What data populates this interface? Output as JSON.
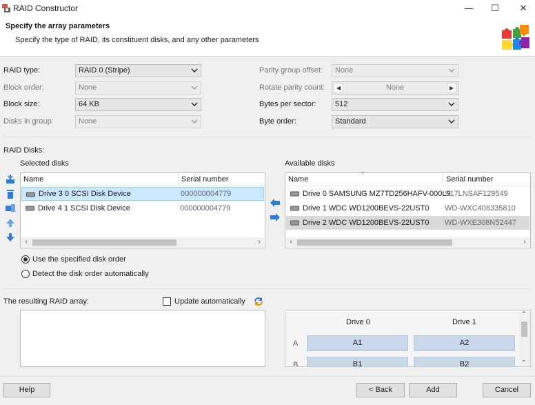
{
  "window": {
    "title": "RAID Constructor",
    "minimize": "—",
    "maximize": "☐",
    "close": "✕"
  },
  "header": {
    "heading": "Specify the array parameters",
    "description": "Specify the type of RAID, its constituent disks, and any other parameters"
  },
  "params": {
    "raid_type_label": "RAID type:",
    "raid_type_value": "RAID 0 (Stripe)",
    "block_order_label": "Block order:",
    "block_order_value": "None",
    "block_size_label": "Block size:",
    "block_size_value": "64 KB",
    "disks_in_group_label": "Disks in group:",
    "disks_in_group_value": "None",
    "parity_offset_label": "Parity group offset:",
    "parity_offset_value": "None",
    "rotate_parity_label": "Rotate parity count:",
    "rotate_parity_value": "None",
    "bytes_per_sector_label": "Bytes per sector:",
    "bytes_per_sector_value": "512",
    "byte_order_label": "Byte order:",
    "byte_order_value": "Standard"
  },
  "disks": {
    "section_label": "RAID Disks:",
    "selected_label": "Selected disks",
    "available_label": "Available disks",
    "col_name": "Name",
    "col_serial": "Serial number",
    "selected": [
      {
        "name": "Drive 3 0 SCSI Disk Device",
        "serial": "000000004779"
      },
      {
        "name": "Drive 4 1 SCSI Disk Device",
        "serial": "000000004779"
      }
    ],
    "available": [
      {
        "name": "Drive 0 SAMSUNG MZ7TD256HAFV-000L9",
        "serial": "S17LNSAF129549"
      },
      {
        "name": "Drive 1 WDC WD1200BEVS-22UST0",
        "serial": "WD-WXC408335810"
      },
      {
        "name": "Drive 2 WDC WD1200BEVS-22UST0",
        "serial": "WD-WXE308N52447"
      }
    ]
  },
  "order": {
    "use_specified": "Use the specified disk order",
    "detect_auto": "Detect the disk order automatically"
  },
  "result": {
    "label": "The resulting RAID array:",
    "update_auto": "Update automatically",
    "col1": "Drive 0",
    "col2": "Drive 1",
    "row_a": "A",
    "row_b": "B",
    "a1": "A1",
    "a2": "A2",
    "b1": "B1",
    "b2": "B2"
  },
  "footer": {
    "help": "Help",
    "back": "< Back",
    "add": "Add",
    "cancel": "Cancel"
  },
  "colors": {
    "selection": "#cce8ff",
    "cell": "#c9d9ea",
    "arrow_blue": "#2f7bd6"
  }
}
